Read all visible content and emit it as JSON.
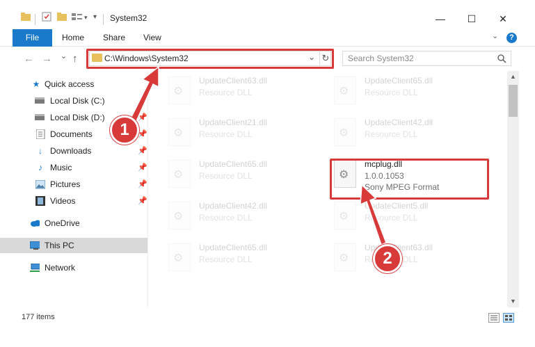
{
  "window": {
    "title": "System32",
    "minimize": "—",
    "maximize": "☐",
    "close": "✕"
  },
  "ribbon": {
    "tabs": [
      {
        "label": "File"
      },
      {
        "label": "Home"
      },
      {
        "label": "Share"
      },
      {
        "label": "View"
      }
    ],
    "help": "?"
  },
  "nav": {
    "back": "←",
    "forward": "→",
    "recent": "⌄",
    "up": "↑",
    "address": "C:\\Windows\\System32",
    "search_placeholder": "Search System32"
  },
  "sidebar": {
    "items": [
      {
        "label": "Quick access",
        "icon": "star-icon"
      },
      {
        "label": "Local Disk (C:)",
        "icon": "drive-icon"
      },
      {
        "label": "Local Disk (D:)",
        "icon": "drive-icon"
      },
      {
        "label": "Documents",
        "icon": "documents-icon"
      },
      {
        "label": "Downloads",
        "icon": "download-icon"
      },
      {
        "label": "Music",
        "icon": "music-icon"
      },
      {
        "label": "Pictures",
        "icon": "pictures-icon"
      },
      {
        "label": "Videos",
        "icon": "videos-icon"
      },
      {
        "label": "OneDrive",
        "icon": "cloud-icon"
      },
      {
        "label": "This PC",
        "icon": "computer-icon"
      },
      {
        "label": "Network",
        "icon": "network-icon"
      }
    ]
  },
  "files": [
    {
      "name": "UpdateClient63.dll",
      "desc": "Resource DLL"
    },
    {
      "name": "UpdateClient65.dll",
      "desc": "Resource DLL"
    },
    {
      "name": "UpdateClient21.dll",
      "desc": "Resource DLL"
    },
    {
      "name": "UpdateClient42.dll",
      "desc": "Resource DLL"
    },
    {
      "name": "UpdateClient65.dll",
      "desc": "Resource DLL"
    },
    {
      "name": "mcplug.dll",
      "desc": "1.0.0.1053",
      "meta": "Sony MPEG Format"
    },
    {
      "name": "UpdateClient42.dll",
      "desc": "Resource DLL"
    },
    {
      "name": "UpdateClient5.dll",
      "desc": "Resource DLL"
    },
    {
      "name": "UpdateClient65.dll",
      "desc": "Resource DLL"
    },
    {
      "name": "UpdateClient63.dll",
      "desc": "Resource DLL"
    }
  ],
  "status": {
    "count": "177 items"
  },
  "annotations": {
    "step1": "1",
    "step2": "2",
    "color": "#d83a3a"
  }
}
